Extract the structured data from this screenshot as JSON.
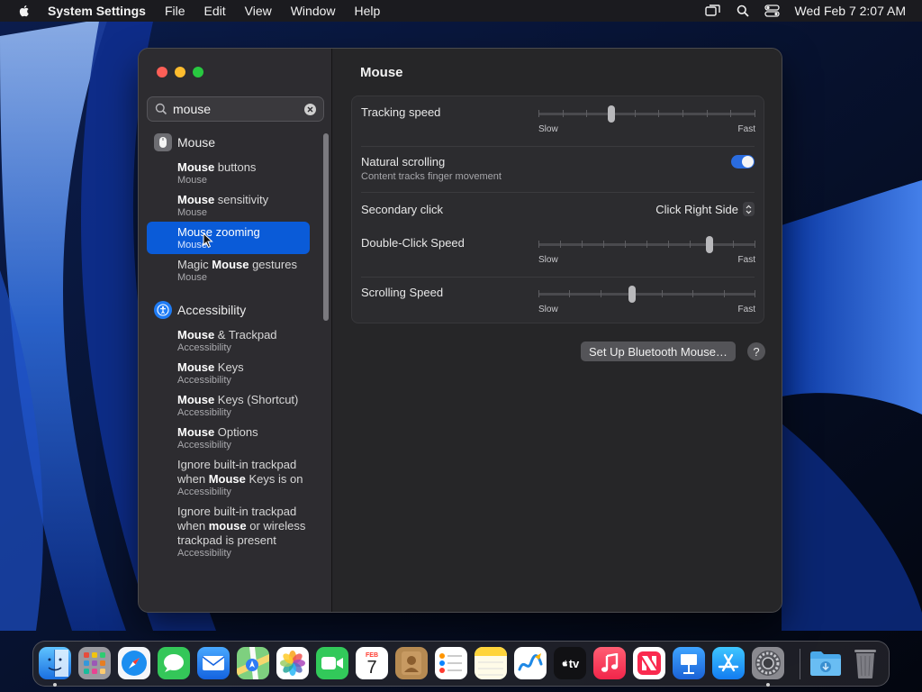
{
  "menubar": {
    "app_name": "System Settings",
    "menus": [
      "File",
      "Edit",
      "View",
      "Window",
      "Help"
    ],
    "clock": "Wed Feb 7  2:07 AM"
  },
  "sidebar": {
    "search": {
      "value": "mouse"
    },
    "groups": [
      {
        "title": "Mouse",
        "items": [
          {
            "bold": "Mouse",
            "rest": " buttons",
            "sub": "Mouse"
          },
          {
            "bold": "Mouse",
            "rest": " sensitivity",
            "sub": "Mouse"
          },
          {
            "bold": "Mouse",
            "rest": " zooming",
            "sub": "Mouse",
            "selected": true
          },
          {
            "pre": "Magic ",
            "bold": "Mouse",
            "rest": " gestures",
            "sub": "Mouse"
          }
        ]
      },
      {
        "title": "Accessibility",
        "items": [
          {
            "bold": "Mouse",
            "rest": " & Trackpad",
            "sub": "Accessibility"
          },
          {
            "bold": "Mouse",
            "rest": " Keys",
            "sub": "Accessibility"
          },
          {
            "bold": "Mouse",
            "rest": " Keys (Shortcut)",
            "sub": "Accessibility"
          },
          {
            "bold": "Mouse",
            "rest": " Options",
            "sub": "Accessibility"
          },
          {
            "pre": "Ignore built-in trackpad when ",
            "bold": "Mouse",
            "rest": " Keys is on",
            "sub": "Accessibility"
          },
          {
            "pre": "Ignore built-in trackpad when ",
            "bold": "mouse",
            "rest": " or wireless trackpad is present",
            "sub": "Accessibility"
          }
        ]
      }
    ]
  },
  "content": {
    "title": "Mouse",
    "tracking_speed": {
      "label": "Tracking speed",
      "min_label": "Slow",
      "max_label": "Fast",
      "value": 0.33
    },
    "natural_scrolling": {
      "label": "Natural scrolling",
      "sublabel": "Content tracks finger movement",
      "on": true
    },
    "secondary_click": {
      "label": "Secondary click",
      "value": "Click Right Side"
    },
    "double_click_speed": {
      "label": "Double-Click Speed",
      "min_label": "Slow",
      "max_label": "Fast",
      "value": 0.8
    },
    "scrolling_speed": {
      "label": "Scrolling Speed",
      "min_label": "Slow",
      "max_label": "Fast",
      "value": 0.43
    },
    "bt_button": "Set Up Bluetooth Mouse…",
    "help": "?"
  },
  "colors": {
    "accent": "#0a5bd8",
    "toggle_on": "#2a6cdf",
    "close": "#fe5f57",
    "minimize": "#febc2e",
    "maximize": "#28c840"
  },
  "dock": {
    "calendar_month": "FEB",
    "calendar_day": "7",
    "tv_label": "tv",
    "apps": [
      "finder",
      "launchpad",
      "safari",
      "messages",
      "mail",
      "maps",
      "photos",
      "facetime",
      "calendar",
      "contacts",
      "reminders",
      "notes",
      "freeform",
      "tv",
      "music",
      "news",
      "keynote",
      "app-store",
      "system-settings",
      "downloads",
      "trash"
    ]
  }
}
